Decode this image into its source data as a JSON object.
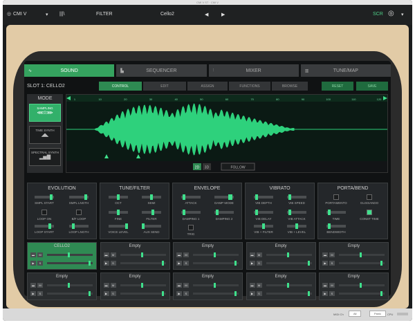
{
  "window": {
    "title": "CMI V ST · CMI V"
  },
  "topbar": {
    "logo": "CMI V",
    "menu": "FILTER",
    "preset": "Cello2",
    "scr": "SCR"
  },
  "tabs": [
    {
      "label": "SOUND",
      "active": true
    },
    {
      "label": "SEQUENCER"
    },
    {
      "label": "MIXER"
    },
    {
      "label": "TUNE/MAP"
    }
  ],
  "slot": {
    "label": "SLOT 1:",
    "name": "CELLO2"
  },
  "subtabs": [
    {
      "label": "CONTROL",
      "active": true
    },
    {
      "label": "EDIT"
    },
    {
      "label": "ASSIGN"
    },
    {
      "label": "FUNCTIONS"
    },
    {
      "label": "BROWSE"
    }
  ],
  "buttons": {
    "reset": "RESET",
    "save": "SAVE"
  },
  "mode": {
    "title": "MODE",
    "items": [
      {
        "label": "SAMPLING",
        "active": true
      },
      {
        "label": "TIME SYNTH"
      },
      {
        "label": "SPECTRAL SYNTH"
      }
    ]
  },
  "wave": {
    "view2d": "2D",
    "view3d": "3D",
    "follow": "FOLLOW",
    "ticks": [
      "1",
      "10",
      "20",
      "30",
      "40",
      "50",
      "60",
      "70",
      "80",
      "90",
      "100",
      "110",
      "120"
    ]
  },
  "sections": [
    {
      "title": "EVOLUTION",
      "controls": [
        "SMPL START",
        "SMPL LNGTH",
        "LOOP ON",
        "B/F LOOP",
        "LOOP START",
        "LOOP LNGTH"
      ]
    },
    {
      "title": "TUNE/FILTER",
      "controls": [
        "OCT",
        "SEMI",
        "FINE",
        "FILTER",
        "VOICE LEVEL",
        "AUX SEND"
      ]
    },
    {
      "title": "ENVELOPE",
      "controls": [
        "ATTACK",
        "DAMP MODE",
        "DAMPING 1",
        "DAMPING 2",
        "TRIG"
      ]
    },
    {
      "title": "VIBRATO",
      "controls": [
        "VIB DEPTH",
        "VIB SPEED",
        "VIB DELAY",
        "VIB ATTACK",
        "VIB + FILTER",
        "VIB + LEVEL"
      ]
    },
    {
      "title": "PORTA/BEND",
      "controls": [
        "PORTAMENTO",
        "GLISSANDO",
        "TIME",
        "CONST TIME",
        "BENDWIDTH"
      ]
    }
  ],
  "slots": [
    {
      "name": "CELLO2",
      "active": true
    },
    {
      "name": "Empty"
    },
    {
      "name": "Empty"
    },
    {
      "name": "Empty"
    },
    {
      "name": "Empty"
    },
    {
      "name": "Empty"
    },
    {
      "name": "Empty"
    },
    {
      "name": "Empty"
    },
    {
      "name": "Empty"
    },
    {
      "name": "Empty"
    }
  ],
  "slot_mini": {
    "m": "M",
    "s": "S"
  },
  "status": {
    "midi": "MIDI Ch",
    "all": "All",
    "panic": "Panic",
    "cpu": "CPU"
  }
}
